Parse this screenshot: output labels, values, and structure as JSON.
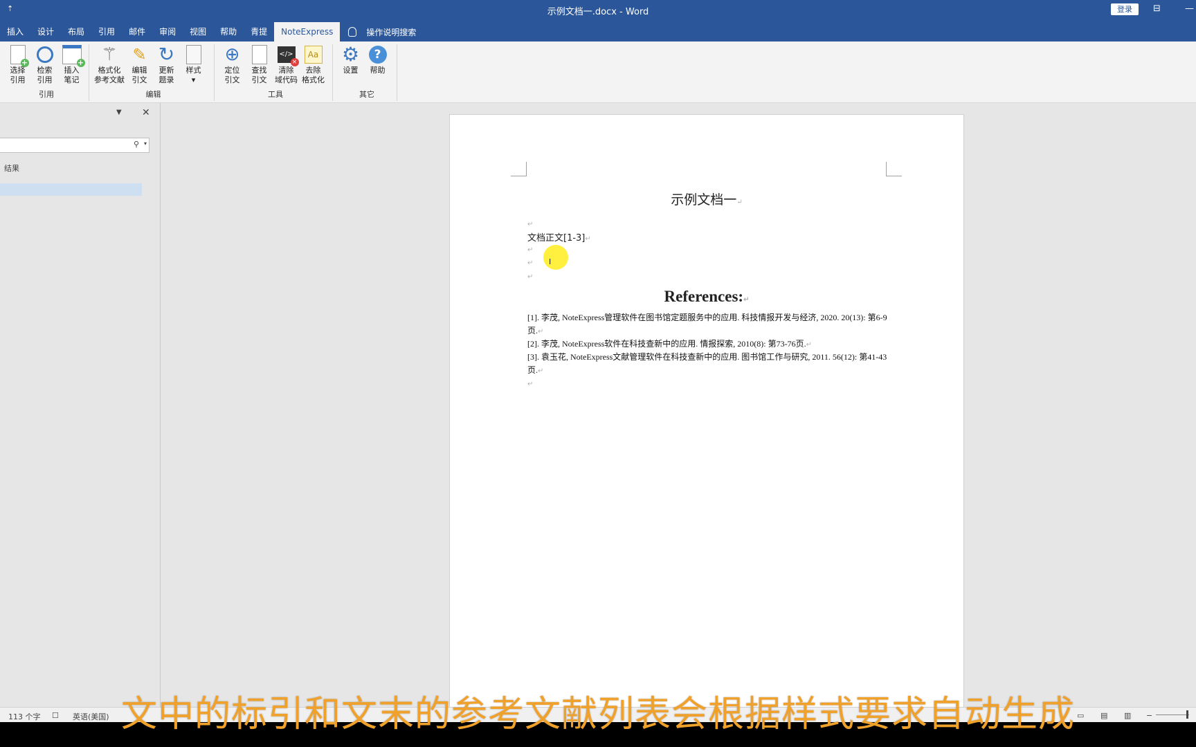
{
  "titlebar": {
    "quick_access": "⇡",
    "title": "示例文档一.docx  -  Word",
    "login": "登录",
    "ribbon_display_icon": "ribbon-display-icon",
    "minimize": "—"
  },
  "tabs": [
    "插入",
    "设计",
    "布局",
    "引用",
    "邮件",
    "审阅",
    "视图",
    "帮助",
    "青提",
    "NoteExpress"
  ],
  "active_tab": "NoteExpress",
  "tell_me": "操作说明搜索",
  "ribbon": {
    "groups": [
      {
        "label": "引用",
        "buttons": [
          {
            "line1": "选择",
            "line2": "引用",
            "icon": "select-citation-icon"
          },
          {
            "line1": "检索",
            "line2": "引用",
            "icon": "search-citation-icon"
          },
          {
            "line1": "插入",
            "line2": "笔记",
            "icon": "insert-note-icon"
          }
        ]
      },
      {
        "label": "编辑",
        "buttons": [
          {
            "line1": "格式化",
            "line2": "参考文献",
            "icon": "format-bibliography-icon"
          },
          {
            "line1": "编辑",
            "line2": "引文",
            "icon": "edit-citation-icon"
          },
          {
            "line1": "更新",
            "line2": "题录",
            "icon": "update-records-icon"
          },
          {
            "line1": "样式",
            "line2": "▾",
            "icon": "style-icon"
          }
        ]
      },
      {
        "label": "工具",
        "buttons": [
          {
            "line1": "定位",
            "line2": "引文",
            "icon": "locate-citation-icon"
          },
          {
            "line1": "查找",
            "line2": "引文",
            "icon": "find-citation-icon"
          },
          {
            "line1": "清除",
            "line2": "域代码",
            "icon": "clear-field-code-icon"
          },
          {
            "line1": "去除",
            "line2": "格式化",
            "icon": "remove-format-icon"
          }
        ]
      },
      {
        "label": "其它",
        "buttons": [
          {
            "line1": "设置",
            "line2": "",
            "icon": "settings-icon"
          },
          {
            "line1": "帮助",
            "line2": "",
            "icon": "help-icon"
          }
        ]
      }
    ]
  },
  "pane": {
    "results_label": "结果"
  },
  "document": {
    "title": "示例文档一",
    "body_text": "文档正文[1-3]",
    "references_heading": "References:",
    "references": [
      "[1].   李茂, NoteExpress管理软件在图书馆定题服务中的应用. 科技情报开发与经济, 2020. 20(13): 第6-9页.",
      "[2].   李茂, NoteExpress软件在科技查新中的应用. 情报探索, 2010(8): 第73-76页.",
      "[3].   袁玉花, NoteExpress文献管理软件在科技查新中的应用. 图书馆工作与研究, 2011. 56(12): 第41-43页."
    ],
    "paragraph_mark": "↵"
  },
  "status": {
    "word_count": "113 个字",
    "language": "英语(美国)"
  },
  "caption": "文中的标引和文末的参考文献列表会根据样式要求自动生成"
}
